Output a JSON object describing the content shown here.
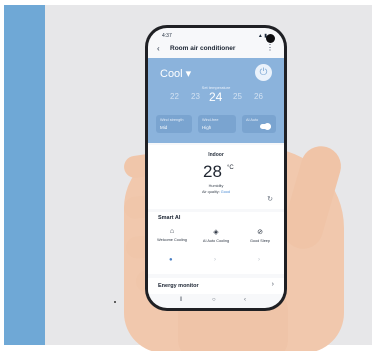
{
  "app": {
    "status_time": "4:37",
    "status_icons": "▲ ▮",
    "title": "Room air conditioner"
  },
  "control": {
    "mode": "Cool ▾",
    "set_temp_label": "Set temperature",
    "temps": [
      "22",
      "23",
      "24",
      "25",
      "26"
    ],
    "selected_temp": "24",
    "wind_label": "Wind strength",
    "wind_value": "Mid",
    "wind_free_label": "Wind-free",
    "wind_free_value": "High",
    "toggle_label": "AI Auto"
  },
  "indoor": {
    "label": "Indoor",
    "temperature": "28",
    "unit": "°C",
    "status": "Humidity",
    "quality_prefix": "Air quality: ",
    "quality_value": "Good"
  },
  "smart_ai": {
    "title": "Smart AI",
    "items": [
      {
        "label": "Welcome Cooling",
        "icon": "home-icon"
      },
      {
        "label": "AI Auto Cooling",
        "icon": "ai-icon"
      },
      {
        "label": "Good Sleep",
        "icon": "sleep-icon"
      }
    ]
  },
  "energy": {
    "label": "Energy monitor"
  },
  "colors": {
    "accent_blue": "#8bb3dc",
    "strip_blue": "#6fa8d6",
    "skin": "#f1c8ad"
  }
}
